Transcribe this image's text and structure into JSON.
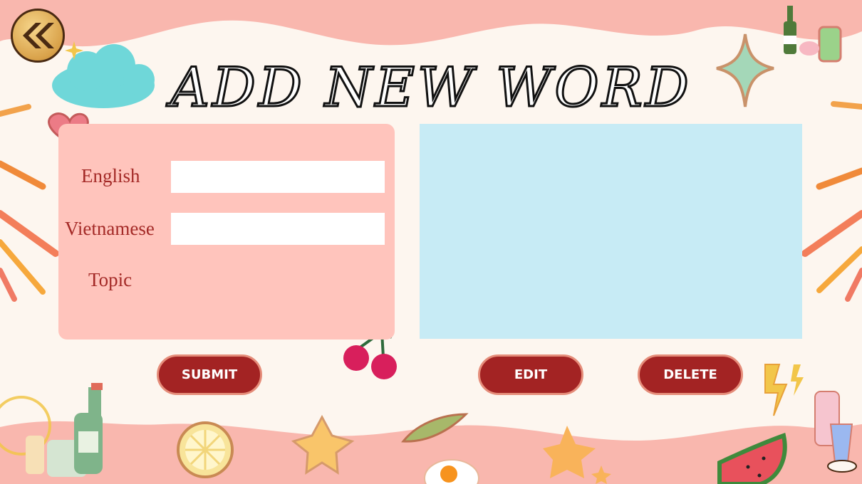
{
  "page": {
    "title": "ADD NEW WORD"
  },
  "nav": {
    "back_icon": "double-chevron-left-icon"
  },
  "form": {
    "english_label": "English",
    "vietnamese_label": "Vietnamese",
    "topic_label": "Topic",
    "english_value": "",
    "vietnamese_value": ""
  },
  "actions": {
    "submit_label": "SUBMIT",
    "edit_label": "EDIT",
    "delete_label": "DELETE"
  },
  "colors": {
    "background": "#fdf6ef",
    "wave": "#f9b7ae",
    "form_panel": "#ffc4bc",
    "list_panel": "#c7ebf5",
    "button": "#a32323",
    "label": "#a42a27"
  },
  "decorations": [
    "cloud-icon",
    "heart-icon",
    "sparkle-star-icon",
    "cherry-icon",
    "lemon-slice-icon",
    "star-icon",
    "leaf-icon",
    "fried-egg-icon",
    "lightning-icon",
    "watermelon-icon",
    "bottle-icon",
    "drink-cup-icon"
  ]
}
